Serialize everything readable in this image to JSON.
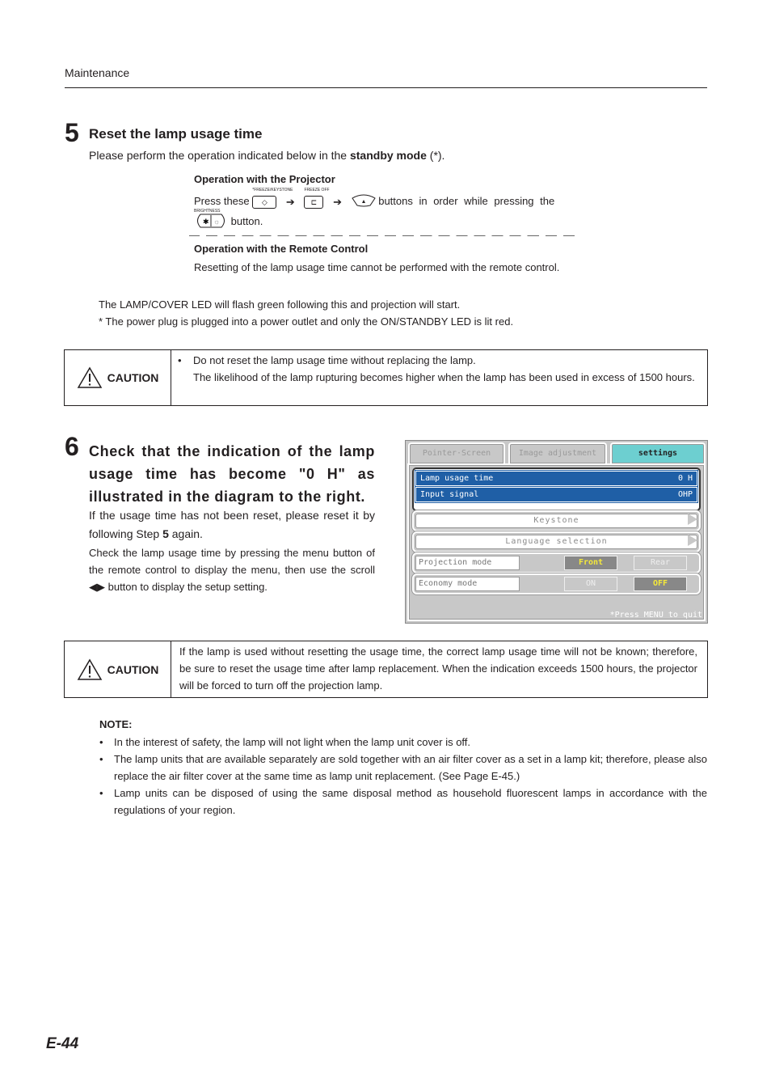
{
  "header": {
    "section": "Maintenance"
  },
  "step5": {
    "number": "5",
    "title": "Reset the lamp usage time",
    "desc_prefix": "Please perform the operation indicated below in the ",
    "desc_bold": "standby mode",
    "desc_suffix": " (*).",
    "projector_op": {
      "heading": "Operation with the Projector",
      "press": "Press these",
      "button1_label": "*FREEZE/KEYSTONE",
      "button2_label": "FREEZE OFF",
      "arrow": "➔",
      "tail": "buttons in order while pressing the",
      "brightness_label": "BRIGHTNESS",
      "end": "button."
    },
    "remote_op": {
      "heading": "Operation with the Remote Control",
      "text": "Resetting of the lamp usage time cannot be performed with the remote control."
    },
    "after1": "The LAMP/COVER LED will flash green following this and projection will start.",
    "after2": "* The power plug is plugged into a power outlet and only the ON/STANDBY LED is lit red."
  },
  "caution1": {
    "label": "CAUTION",
    "bullet": "•",
    "line1": "Do not reset the lamp usage time without replacing the lamp.",
    "line2": "The likelihood of the lamp rupturing becomes higher when the lamp has been used in excess of 1500 hours."
  },
  "step6": {
    "number": "6",
    "title": "Check that the indication of the lamp usage time has become \"0 H\" as illustrated in the diagram to the right.",
    "p1_prefix": "If the usage time has not been reset, please reset it by following Step ",
    "p1_bold": "5",
    "p1_suffix": " again.",
    "p2": "Check the lamp usage time by pressing the menu button of the remote control to display the menu, then use the scroll ◀▶ button to display the setup setting."
  },
  "menu": {
    "tabs": [
      {
        "label": "Pointer·Screen",
        "active": false
      },
      {
        "label": "Image adjustment",
        "active": false
      },
      {
        "label": "settings",
        "active": true
      }
    ],
    "info": [
      {
        "label": "Lamp usage time",
        "value": "0 H"
      },
      {
        "label": "Input signal",
        "value": "OHP"
      }
    ],
    "submenus": [
      "Keystone",
      "Language selection"
    ],
    "projection": {
      "label": "Projection mode",
      "options": [
        "Front",
        "Rear"
      ],
      "selected": "Front"
    },
    "economy": {
      "label": "Economy mode",
      "options": [
        "ON",
        "OFF"
      ],
      "selected": "OFF"
    },
    "quit_hint": "*Press MENU to quit",
    "colors": {
      "tab_active": "#6dcfd0",
      "info_bg": "#1f5fa6",
      "selected_text": "#f5e93a"
    }
  },
  "caution2": {
    "label": "CAUTION",
    "text": "If the lamp is used without resetting the usage time, the correct lamp usage time will not be known; therefore, be sure to reset the usage time after lamp replacement. When the indication exceeds 1500 hours, the projector will be forced to turn off the projection lamp."
  },
  "note": {
    "heading": "NOTE:",
    "items": [
      "In the interest of safety, the lamp will not light when the lamp unit cover is off.",
      "The lamp units that are available separately are sold together with an air filter cover as a set in a lamp kit; therefore, please also replace the air filter cover at the same time as lamp unit replacement. (See Page E-45.)",
      "Lamp units can be disposed of using the same disposal method as household fluorescent lamps in accordance with the regulations of your region."
    ]
  },
  "page_number": "E-44"
}
